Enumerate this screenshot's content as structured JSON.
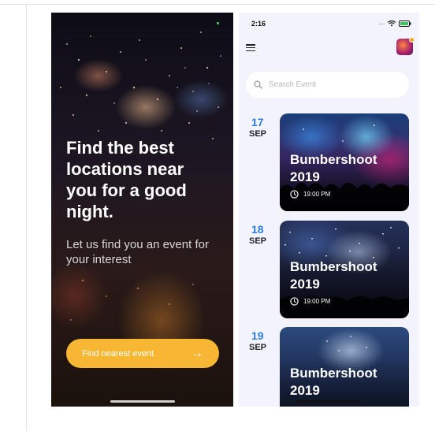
{
  "welcome_screen": {
    "headline": "Find the best locations near you for a good night.",
    "subtitle": "Let us find you an event for your interest",
    "cta_label": "Find nearest event",
    "cta_icon": "arrow-right-icon",
    "cta_color": "#f7b733"
  },
  "events_screen": {
    "status_bar": {
      "time": "2:16",
      "icons": [
        "signal-dots-icon",
        "wifi-icon",
        "battery-charging-icon"
      ]
    },
    "menu_icon": "hamburger-menu-icon",
    "avatar_badge_color": "#ffa41b",
    "search": {
      "placeholder": "Search Event",
      "value": "",
      "icon": "search-icon"
    },
    "accent_color": "#2f7ddb",
    "events": [
      {
        "day": "17",
        "month": "SEP",
        "title": "Bumbershoot 2019",
        "time": "19:00 PM"
      },
      {
        "day": "18",
        "month": "SEP",
        "title": "Bumbershoot 2019",
        "time": "19:00 PM"
      },
      {
        "day": "19",
        "month": "SEP",
        "title": "Bumbershoot 2019",
        "time": ""
      }
    ]
  }
}
